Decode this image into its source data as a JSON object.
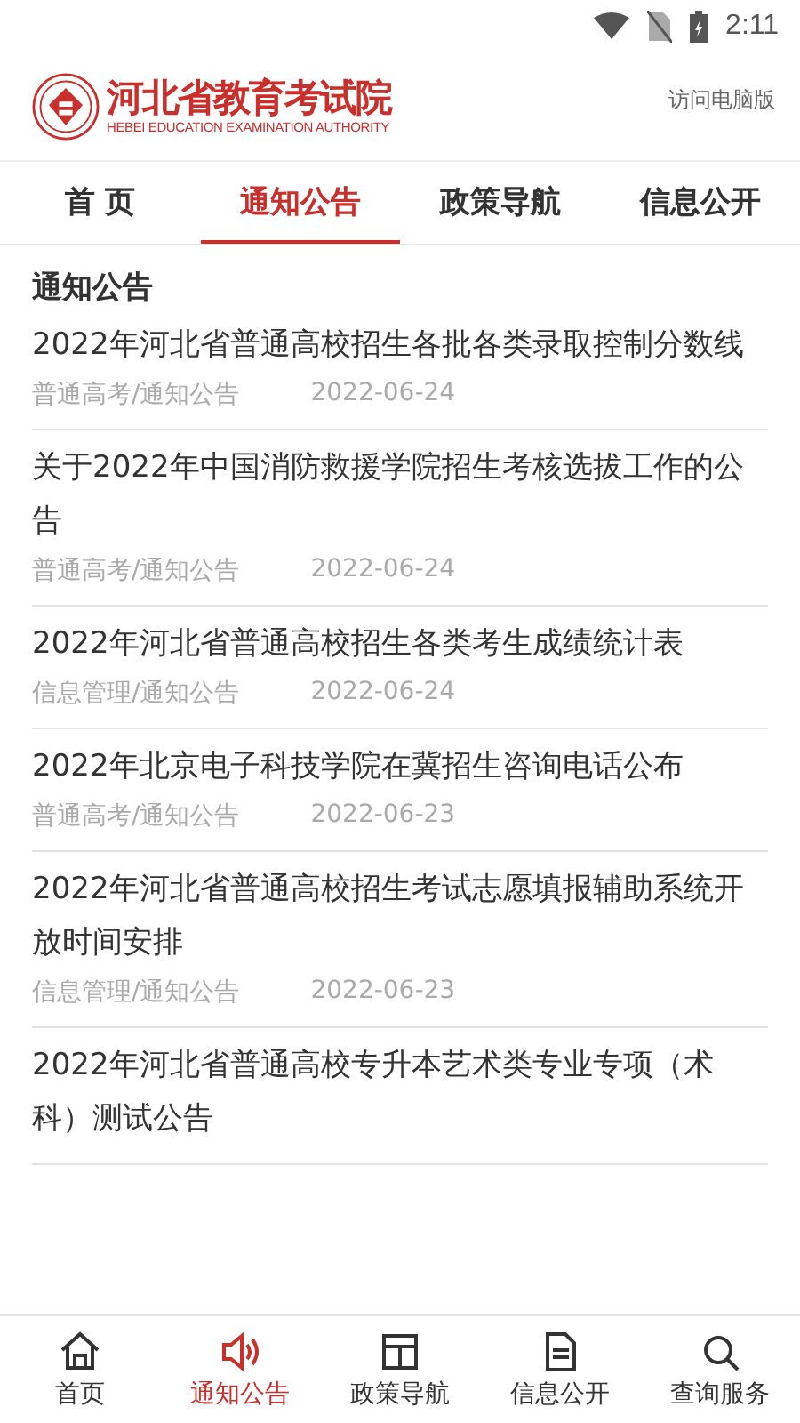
{
  "status_bar": {
    "time": "2:11"
  },
  "header": {
    "logo_title": "河北省教育考试院",
    "logo_subtitle": "HEBEI EDUCATION EXAMINATION AUTHORITY",
    "desktop_link": "访问电脑版"
  },
  "tabs": [
    {
      "label": "首 页",
      "selected": false
    },
    {
      "label": "通知公告",
      "selected": true
    },
    {
      "label": "政策导航",
      "selected": false
    },
    {
      "label": "信息公开",
      "selected": false
    }
  ],
  "section_title": "通知公告",
  "articles": [
    {
      "title": "2022年河北省普通高校招生各批各类录取控制分数线",
      "category": "普通高考/通知公告",
      "date": "2022-06-24"
    },
    {
      "title": "关于2022年中国消防救援学院招生考核选拔工作的公告",
      "category": "普通高考/通知公告",
      "date": "2022-06-24"
    },
    {
      "title": "2022年河北省普通高校招生各类考生成绩统计表",
      "category": "信息管理/通知公告",
      "date": "2022-06-24"
    },
    {
      "title": "2022年北京电子科技学院在冀招生咨询电话公布",
      "category": "普通高考/通知公告",
      "date": "2022-06-23"
    },
    {
      "title": "2022年河北省普通高校招生考试志愿填报辅助系统开放时间安排",
      "category": "信息管理/通知公告",
      "date": "2022-06-23"
    },
    {
      "title": "2022年河北省普通高校专升本艺术类专业专项（术科）测试公告"
    }
  ],
  "bottom_nav": [
    {
      "kind": "home",
      "label": "首页",
      "selected": false
    },
    {
      "kind": "speaker",
      "label": "通知公告",
      "selected": true
    },
    {
      "kind": "book",
      "label": "政策导航",
      "selected": false
    },
    {
      "kind": "document",
      "label": "信息公开",
      "selected": false
    },
    {
      "kind": "search",
      "label": "查询服务",
      "selected": false
    }
  ]
}
